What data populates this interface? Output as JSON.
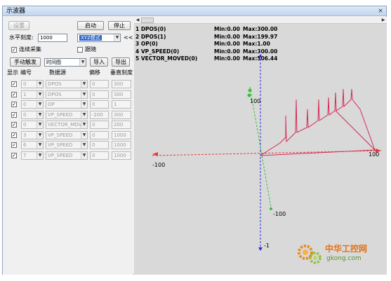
{
  "window": {
    "title": "示波器",
    "close_glyph": "×"
  },
  "left": {
    "settings_button": "设置",
    "start_button": "启动",
    "stop_button": "停止",
    "horizontal_scale_label": "水平刻度:",
    "horizontal_scale_value": "1000",
    "mode_combo_value": "XYZ模式",
    "collapse_button": "<<",
    "continuous_capture_label": "连续采集",
    "continuous_capture_checked": true,
    "follow_label": "跟随",
    "follow_checked": false,
    "manual_trigger_button": "手动触发",
    "display_mode_value": "时间图",
    "import_button": "导入",
    "export_button": "导出",
    "table_headers": [
      "显示",
      "编号",
      "数据源",
      "偏移",
      "垂直刻度"
    ],
    "rows": [
      {
        "show": true,
        "number": "0",
        "source": "DPOS",
        "offset": "0",
        "scale": "300",
        "enabled": false
      },
      {
        "show": true,
        "number": "1",
        "source": "DPOS",
        "offset": "0",
        "scale": "300",
        "enabled": false
      },
      {
        "show": true,
        "number": "0",
        "source": "OP",
        "offset": "0",
        "scale": "1",
        "enabled": false
      },
      {
        "show": true,
        "number": "0",
        "source": "VP_SPEED",
        "offset": "-200",
        "scale": "300",
        "enabled": false
      },
      {
        "show": true,
        "number": "0",
        "source": "VECTOR_MOVED",
        "offset": "0",
        "scale": "200",
        "enabled": false
      },
      {
        "show": true,
        "number": "3",
        "source": "VP_SPEED",
        "offset": "0",
        "scale": "1000",
        "enabled": false
      },
      {
        "show": true,
        "number": "6",
        "source": "VP_SPEED",
        "offset": "0",
        "scale": "1000",
        "enabled": false
      },
      {
        "show": true,
        "number": "7",
        "source": "VP_SPEED",
        "offset": "0",
        "scale": "1000",
        "enabled": false
      }
    ]
  },
  "plot": {
    "legend": [
      {
        "name": "1 DPOS(0)",
        "min": "Min:0.00",
        "max": "Max:300.00"
      },
      {
        "name": "2 DPOS(1)",
        "min": "Min:0.00",
        "max": "Max:199.97"
      },
      {
        "name": "3 OP(0)",
        "min": "Min:0.00",
        "max": "Max:1.00"
      },
      {
        "name": "4 VP_SPEED(0)",
        "min": "Min:0.00",
        "max": "Max:300.00"
      },
      {
        "name": "5 VECTOR_MOVED(0)",
        "min": "Min:0.00",
        "max": "Max:506.44"
      }
    ],
    "axis_labels": {
      "x_neg": "-100",
      "x_pos": "100",
      "y_pos": "100",
      "y_neg": "-100",
      "z_neg": "-1"
    },
    "colors": {
      "x_axis": "#e03b3b",
      "y_axis": "#36c236",
      "z_axis": "#2a2ad6",
      "trace": "#d62a55",
      "background": "#d9d9d9"
    }
  },
  "watermark": {
    "line1": "中华工控网",
    "line2": "gkong.com"
  }
}
